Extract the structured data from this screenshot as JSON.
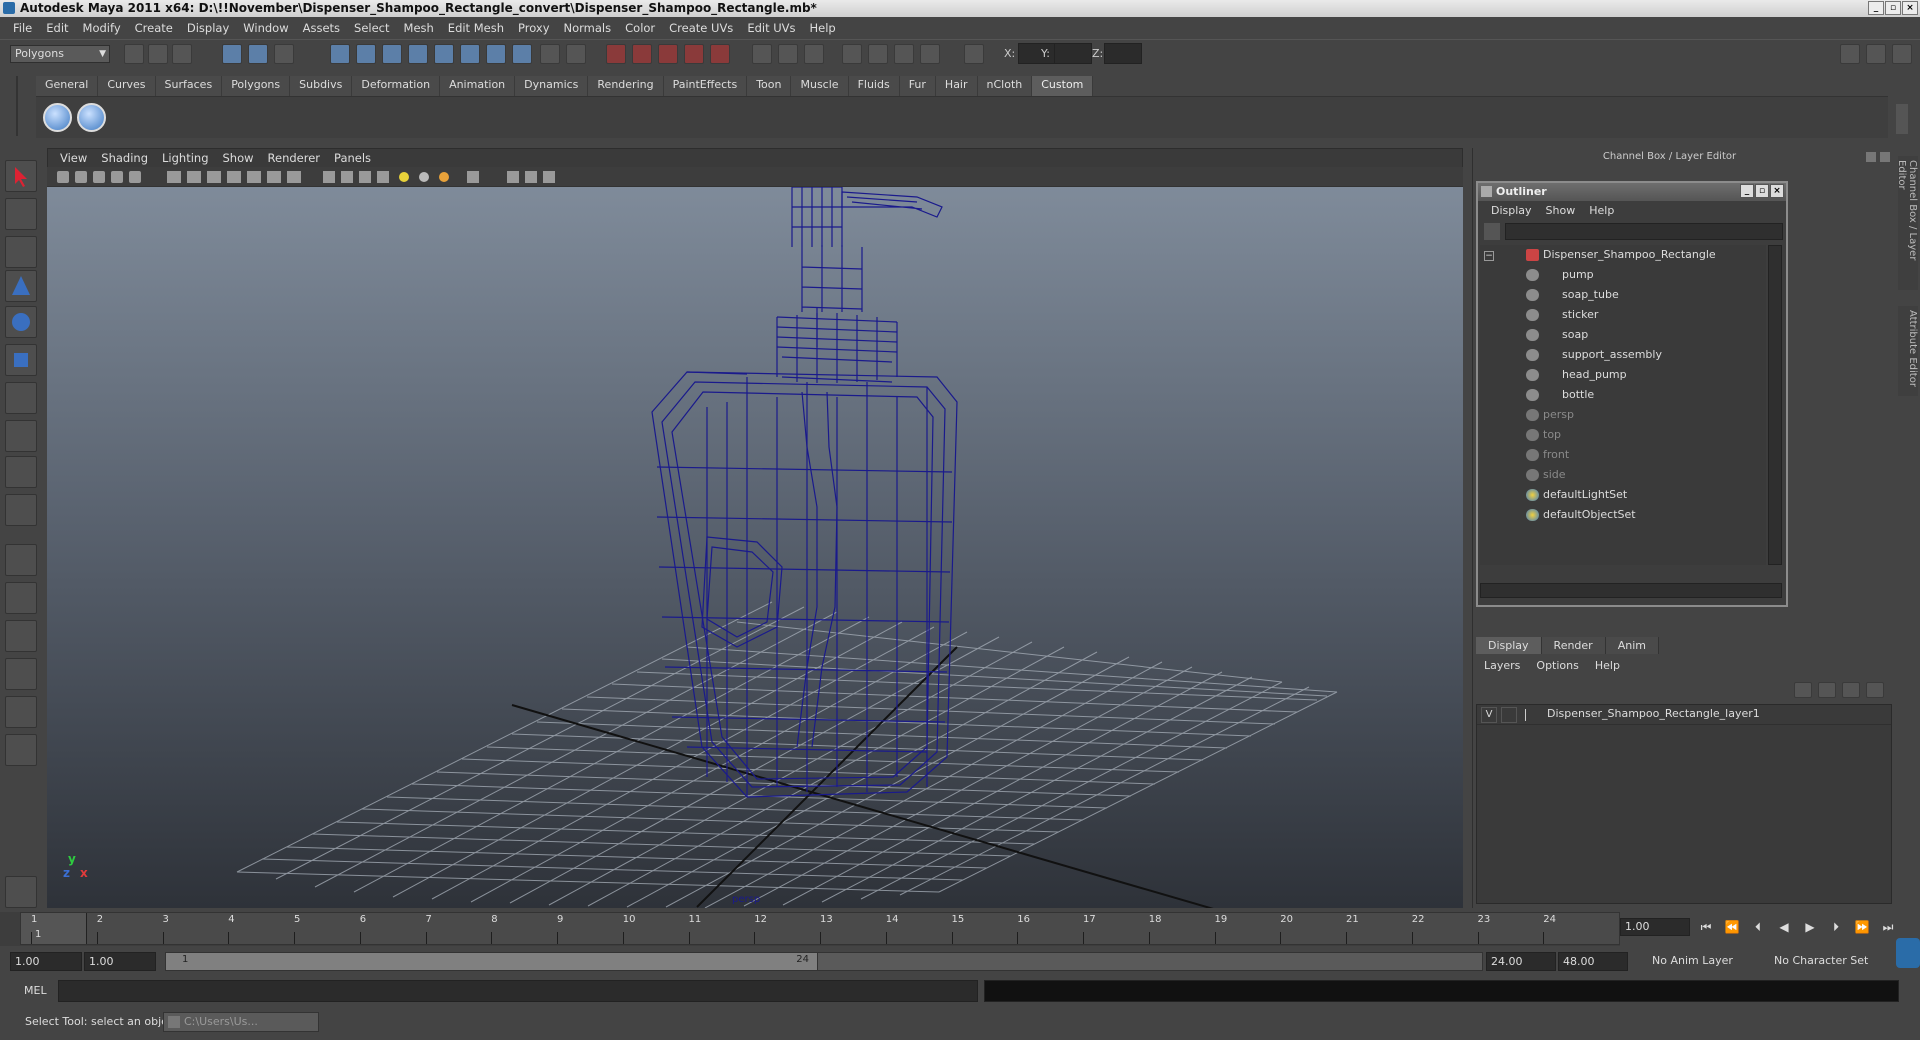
{
  "title": "Autodesk Maya 2011 x64: D:\\!!November\\Dispenser_Shampoo_Rectangle_convert\\Dispenser_Shampoo_Rectangle.mb*",
  "menu": [
    "File",
    "Edit",
    "Modify",
    "Create",
    "Display",
    "Window",
    "Assets",
    "Select",
    "Mesh",
    "Edit Mesh",
    "Proxy",
    "Normals",
    "Color",
    "Create UVs",
    "Edit UVs",
    "Help"
  ],
  "mode_select": "Polygons",
  "coords": {
    "x_label": "X:",
    "y_label": "Y:",
    "z_label": "Z:"
  },
  "shelf_tabs": [
    "General",
    "Curves",
    "Surfaces",
    "Polygons",
    "Subdivs",
    "Deformation",
    "Animation",
    "Dynamics",
    "Rendering",
    "PaintEffects",
    "Toon",
    "Muscle",
    "Fluids",
    "Fur",
    "Hair",
    "nCloth",
    "Custom"
  ],
  "active_shelf": "Custom",
  "viewport_menu": [
    "View",
    "Shading",
    "Lighting",
    "Show",
    "Renderer",
    "Panels"
  ],
  "viewport_label": "persp",
  "axis": {
    "y": "y",
    "x": "x",
    "z": "z"
  },
  "channel_box_title": "Channel Box / Layer Editor",
  "side_tabs": [
    "Channel Box / Layer Editor",
    "Attribute Editor"
  ],
  "outliner": {
    "title": "Outliner",
    "menu": [
      "Display",
      "Show",
      "Help"
    ],
    "items": [
      {
        "label": "Dispenser_Shampoo_Rectangle",
        "indent": 0,
        "dim": false
      },
      {
        "label": "pump",
        "indent": 1,
        "dim": false
      },
      {
        "label": "soap_tube",
        "indent": 1,
        "dim": false
      },
      {
        "label": "sticker",
        "indent": 1,
        "dim": false
      },
      {
        "label": "soap",
        "indent": 1,
        "dim": false
      },
      {
        "label": "support_assembly",
        "indent": 1,
        "dim": false
      },
      {
        "label": "head_pump",
        "indent": 1,
        "dim": false
      },
      {
        "label": "bottle",
        "indent": 1,
        "dim": false
      },
      {
        "label": "persp",
        "indent": 0,
        "dim": true
      },
      {
        "label": "top",
        "indent": 0,
        "dim": true
      },
      {
        "label": "front",
        "indent": 0,
        "dim": true
      },
      {
        "label": "side",
        "indent": 0,
        "dim": true
      },
      {
        "label": "defaultLightSet",
        "indent": 0,
        "dim": false
      },
      {
        "label": "defaultObjectSet",
        "indent": 0,
        "dim": false
      }
    ]
  },
  "layer_editor": {
    "tabs": [
      "Display",
      "Render",
      "Anim"
    ],
    "menu": [
      "Layers",
      "Options",
      "Help"
    ],
    "layer": {
      "visible": "V",
      "name": "Dispenser_Shampoo_Rectangle_layer1"
    }
  },
  "timeline": {
    "ticks": [
      "1",
      "2",
      "3",
      "4",
      "5",
      "6",
      "7",
      "8",
      "9",
      "10",
      "11",
      "12",
      "13",
      "14",
      "15",
      "16",
      "17",
      "18",
      "19",
      "20",
      "21",
      "22",
      "23",
      "24"
    ],
    "current_frame": "1.00",
    "current_marker": "1"
  },
  "range": {
    "start": "1.00",
    "start2": "1.00",
    "slider_start": "1",
    "slider_end": "24",
    "end": "24.00",
    "end2": "48.00",
    "anim_layer": "No Anim Layer",
    "char_set": "No Character Set"
  },
  "command": {
    "label": "MEL"
  },
  "help_line": "Select Tool: select an object",
  "taskbar_item": "C:\\Users\\Us..."
}
